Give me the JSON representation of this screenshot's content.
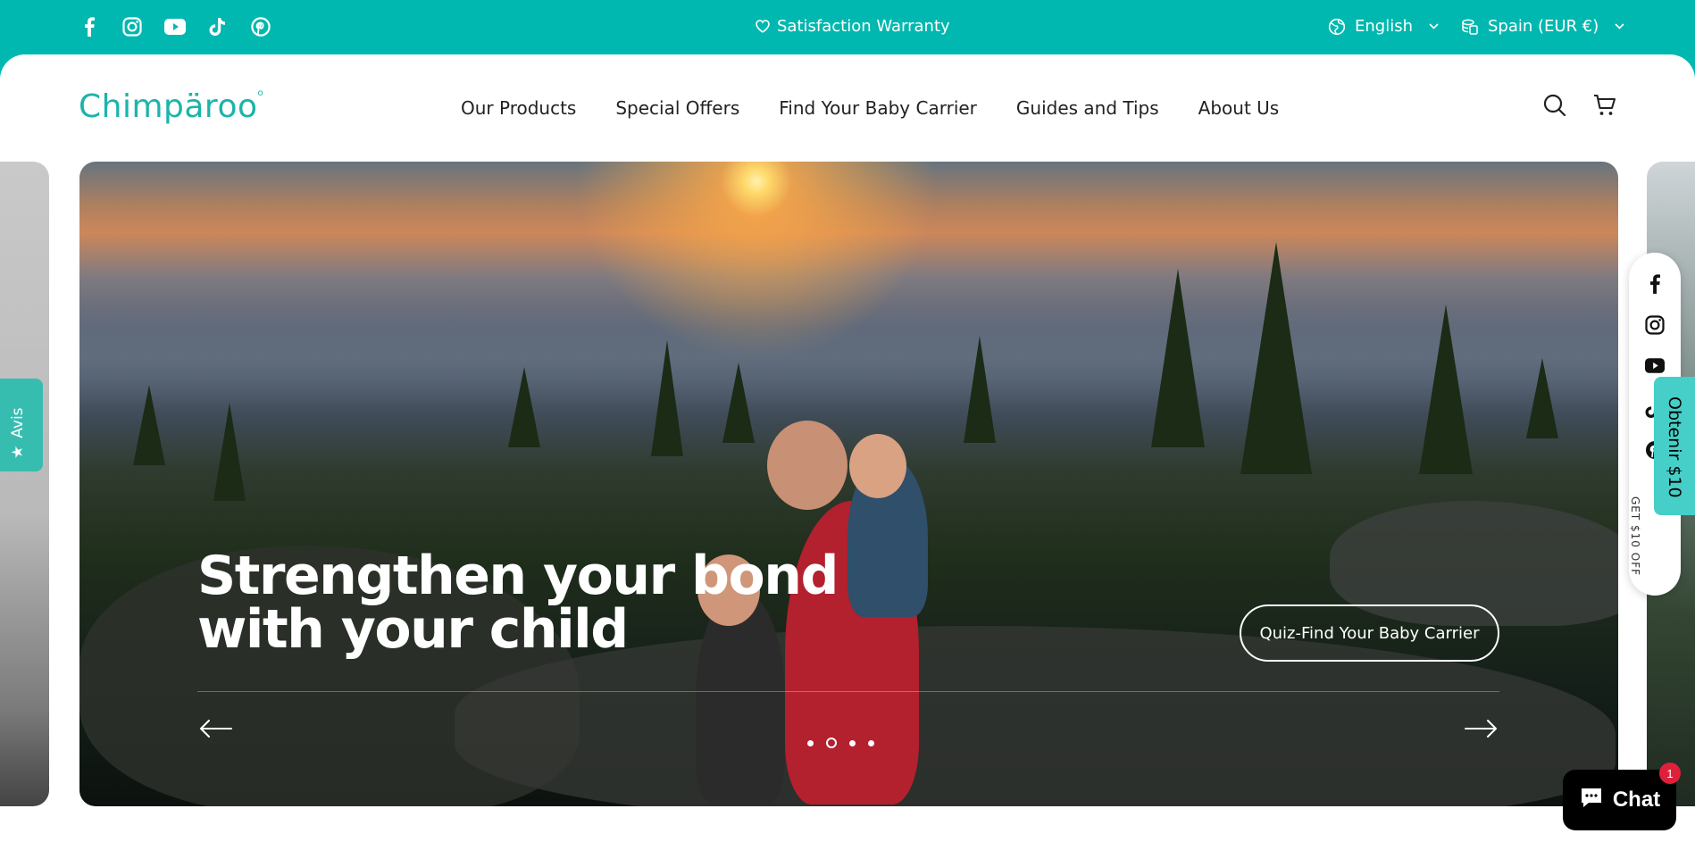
{
  "topbar": {
    "socials": [
      "facebook-icon",
      "instagram-icon",
      "youtube-icon",
      "tiktok-icon",
      "pinterest-icon"
    ],
    "warranty": "Satisfaction Warranty",
    "language": "English",
    "country": "Spain (EUR €)"
  },
  "header": {
    "logo": "Chimpäroo",
    "nav": [
      "Our Products",
      "Special Offers",
      "Find Your Baby Carrier",
      "Guides and Tips",
      "About Us"
    ]
  },
  "hero": {
    "title_line1": "Strengthen your bond",
    "title_line2": "with your child",
    "cta": "Quiz-Find Your Baby Carrier",
    "slide_count": 4,
    "active_slide": 2
  },
  "reviews_tab": {
    "label": "Avis"
  },
  "reward": {
    "label": "Obtenir $10",
    "rail_label": "GET $10 OFF"
  },
  "chat": {
    "label": "Chat",
    "badge": "1"
  },
  "colors": {
    "brand": "#00b8af",
    "logo": "#1cb4aa",
    "chat_badge": "#e0203a"
  }
}
